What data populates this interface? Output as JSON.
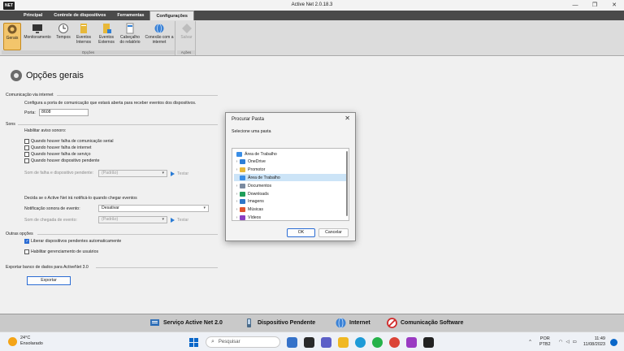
{
  "window": {
    "title": "Active Net 2.0.18.3",
    "logo_text": "NET",
    "controls": [
      "—",
      "❐",
      "✕"
    ]
  },
  "menu": {
    "tabs": [
      "Principal",
      "Controle de dispositivos",
      "Ferramentas",
      "Configurações"
    ],
    "active_tab": "Configurações"
  },
  "ribbon": {
    "buttons": [
      {
        "label": "Gerais"
      },
      {
        "label": "Monitoramento"
      },
      {
        "label": "Tempos"
      },
      {
        "label": "Eventos Internos"
      },
      {
        "label": "Eventos Externos"
      },
      {
        "label": "Cabeçalho do relatório"
      },
      {
        "label": "Conexão com a internet"
      }
    ],
    "group_label": "Opções",
    "save_button": {
      "label": "Salvar"
    },
    "save_group_label": "Ações"
  },
  "page": {
    "title": "Opções gerais",
    "internet": {
      "section": "Comunicação via internet",
      "description": "Configura a porta de comunicação que estará aberta para receber eventos dos dispositivos.",
      "port_label": "Porta:",
      "port_value": "8608"
    },
    "sound": {
      "section": "Sons",
      "enable_label": "Habilitar aviso sonoro:",
      "options": [
        {
          "label": "Quando houver falha de comunicação serial",
          "checked": false
        },
        {
          "label": "Quando houver falha de internet",
          "checked": false
        },
        {
          "label": "Quando houver falha de serviço",
          "checked": false
        },
        {
          "label": "Quando houver dispositivo pendente",
          "checked": false
        }
      ],
      "failure_sound_label": "Som de falha e dispositivo pendente:",
      "failure_sound_value": "(Padrão)",
      "test_label": "Testar",
      "notify_desc": "Decida se o Active Net irá notificá-lo quando chegar eventos",
      "notify_label": "Notificação sonora de evento:",
      "notify_value": "Desativar",
      "arrival_sound_label": "Som de chegada de evento:",
      "arrival_sound_value": "(Padrão)",
      "test_label_2": "Testar"
    },
    "other": {
      "section": "Outras opções",
      "options": [
        {
          "label": "Liberar dispositivos pendentes automaticamente",
          "checked": true
        },
        {
          "label": "Habilitar gerenciamento de usuários",
          "checked": false
        }
      ]
    },
    "export": {
      "section": "Exportar banco de dados para ActiveNet 3.0",
      "button": "Exportar"
    }
  },
  "dialog": {
    "title": "Procurar Pasta",
    "subtitle": "Selecione uma pasta",
    "items": [
      {
        "label": "Área de Trabalho",
        "color": "#3a8ee6",
        "expander": "",
        "indent": 0
      },
      {
        "label": "OneDrive",
        "color": "#2f7fd6",
        "expander": "›",
        "indent": 1
      },
      {
        "label": "Promotor",
        "color": "#e7b83a",
        "expander": "›",
        "indent": 1
      },
      {
        "label": "Área de Trabalho",
        "color": "#3a8ee6",
        "expander": "",
        "indent": 1,
        "selected": true
      },
      {
        "label": "Documentos",
        "color": "#7a8aa0",
        "expander": "›",
        "indent": 1
      },
      {
        "label": "Downloads",
        "color": "#1e9e5a",
        "expander": "›",
        "indent": 1
      },
      {
        "label": "Imagens",
        "color": "#2e77c8",
        "expander": "›",
        "indent": 1
      },
      {
        "label": "Músicas",
        "color": "#e0542f",
        "expander": "›",
        "indent": 1
      },
      {
        "label": "Vídeos",
        "color": "#8a3fc2",
        "expander": "›",
        "indent": 1
      }
    ],
    "ok_label": "OK",
    "cancel_label": "Cancelar"
  },
  "statusbar": {
    "items": [
      {
        "label": "Serviço Active Net 2.0",
        "icon": "service-icon",
        "color": "#2f6fb8"
      },
      {
        "label": "Dispositivo Pendente",
        "icon": "device-icon",
        "color": "#4a6b8a"
      },
      {
        "label": "Internet",
        "icon": "globe-icon",
        "color": "#3b82d6"
      },
      {
        "label": "Comunicação Software",
        "icon": "forbidden-icon",
        "color": "#d12b2b"
      }
    ]
  },
  "taskbar": {
    "weather_temp": "24°C",
    "weather_desc": "Ensolarado",
    "search_placeholder": "Pesquisar",
    "lang_top": "POR",
    "lang_bottom": "PTB2",
    "time": "11:49",
    "date": "11/08/2023"
  }
}
